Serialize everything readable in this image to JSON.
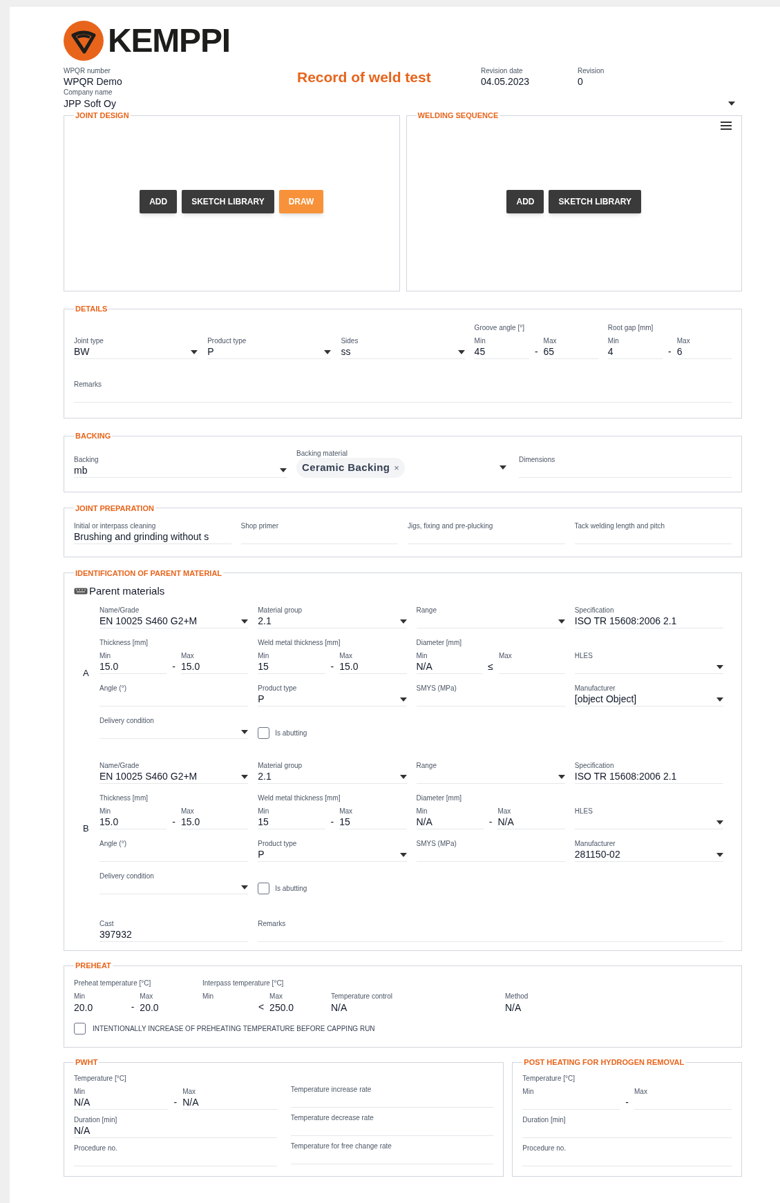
{
  "logo": {
    "text": "KEMPPI"
  },
  "header": {
    "number": {
      "label": "WPQR number",
      "value": "WPQR Demo"
    },
    "title": "Record of weld test",
    "revision_date": {
      "label": "Revision date",
      "value": "04.05.2023"
    },
    "revision": {
      "label": "Revision",
      "value": "0"
    },
    "company": {
      "kind": "dropdown",
      "label": "Company name",
      "value": "JPP Soft Oy"
    }
  },
  "sketch_panels": [
    {
      "title": "JOINT DESIGN",
      "menu": false,
      "buttons": [
        {
          "label": "ADD",
          "primary": false
        },
        {
          "label": "SKETCH LIBRARY",
          "primary": false
        },
        {
          "label": "DRAW",
          "primary": true
        }
      ]
    },
    {
      "title": "WELDING SEQUENCE",
      "menu": true,
      "buttons": [
        {
          "label": "ADD",
          "primary": false
        },
        {
          "label": "SKETCH LIBRARY",
          "primary": false
        }
      ]
    }
  ],
  "sections": [
    {
      "title": "DETAILS",
      "rows": [
        [
          {
            "kind": "dropdown",
            "label": "Joint type",
            "value": "BW"
          },
          {
            "kind": "dropdown",
            "label": "Product type",
            "value": "P"
          },
          {
            "kind": "dropdown",
            "label": "Sides",
            "value": "ss"
          },
          {
            "kind": "range",
            "label": "Groove angle [°]",
            "min_label": "Min",
            "min": "45",
            "separator": "-",
            "max_label": "Max",
            "max": "65"
          },
          {
            "kind": "range",
            "label": "Root gap [mm]",
            "min_label": "Min",
            "min": "4",
            "separator": "-",
            "max_label": "Max",
            "max": "6"
          }
        ],
        [
          {
            "kind": "field",
            "label": "Remarks"
          }
        ]
      ]
    },
    {
      "title": "BACKING",
      "rows": [
        [
          {
            "kind": "dropdown",
            "label": "Backing",
            "value": "mb"
          },
          {
            "kind": "chip",
            "label": "Backing material",
            "chip": "Ceramic Backing",
            "remove": "×"
          },
          {
            "kind": "field",
            "label": "Dimensions"
          }
        ]
      ]
    },
    {
      "title": "JOINT PREPARATION",
      "rows": [
        [
          {
            "kind": "field",
            "label": "Initial or interpass cleaning",
            "value": "Brushing and grinding without s"
          },
          {
            "kind": "field",
            "label": "Shop primer"
          },
          {
            "kind": "field",
            "label": "Jigs, fixing and pre-plucking"
          },
          {
            "kind": "field",
            "label": "Tack welding length and pitch"
          }
        ]
      ]
    }
  ],
  "parent_material": {
    "title": "IDENTIFICATION OF PARENT MATERIAL",
    "heading": "Parent materials",
    "materials": [
      {
        "letter": "A",
        "rows": [
          [
            {
              "kind": "dropdown",
              "label": "Name/Grade",
              "value": "EN 10025 S460 G2+M"
            },
            {
              "kind": "dropdown",
              "label": "Material group",
              "value": "2.1"
            },
            {
              "kind": "dropdown",
              "label": "Range"
            },
            {
              "kind": "field",
              "label": "Specification",
              "value": "ISO TR 15608:2006 2.1"
            }
          ],
          [
            {
              "kind": "range",
              "label": "Thickness [mm]",
              "min_label": "Min",
              "min": "15.0",
              "separator": "-",
              "max_label": "Max",
              "max": "15.0"
            },
            {
              "kind": "range",
              "label": "Weld metal thickness [mm]",
              "min_label": "Min",
              "min": "15",
              "separator": "-",
              "max_label": "Max",
              "max": "15.0"
            },
            {
              "kind": "range",
              "label": "Diameter [mm]",
              "min_label": "Min",
              "min": "N/A",
              "separator": "≤",
              "max_label": "Max"
            },
            {
              "kind": "dropdown",
              "label": "HLES"
            }
          ],
          [
            {
              "kind": "field",
              "label": "Angle (°)"
            },
            {
              "kind": "dropdown",
              "label": "Product type",
              "value": "P"
            },
            {
              "kind": "field",
              "label": "SMYS (MPa)"
            },
            {
              "kind": "dropdown",
              "label": "Manufacturer",
              "value": "[object Object]"
            }
          ],
          [
            {
              "kind": "dropdown",
              "label": "Delivery condition"
            },
            {
              "kind": "checkbox",
              "label": "Is abutting",
              "checked": false
            }
          ]
        ]
      },
      {
        "letter": "B",
        "rows": [
          [
            {
              "kind": "dropdown",
              "label": "Name/Grade",
              "value": "EN 10025 S460 G2+M"
            },
            {
              "kind": "dropdown",
              "label": "Material group",
              "value": "2.1"
            },
            {
              "kind": "dropdown",
              "label": "Range"
            },
            {
              "kind": "field",
              "label": "Specification",
              "value": "ISO TR 15608:2006 2.1"
            }
          ],
          [
            {
              "kind": "range",
              "label": "Thickness [mm]",
              "min_label": "Min",
              "min": "15.0",
              "separator": "-",
              "max_label": "Max",
              "max": "15.0"
            },
            {
              "kind": "range",
              "label": "Weld metal thickness [mm]",
              "min_label": "Min",
              "min": "15",
              "separator": "-",
              "max_label": "Max",
              "max": "15"
            },
            {
              "kind": "range",
              "label": "Diameter [mm]",
              "min_label": "Min",
              "min": "N/A",
              "separator": "-",
              "max_label": "Max",
              "max": "N/A"
            },
            {
              "kind": "dropdown",
              "label": "HLES"
            }
          ],
          [
            {
              "kind": "field",
              "label": "Angle (°)"
            },
            {
              "kind": "dropdown",
              "label": "Product type",
              "value": "P"
            },
            {
              "kind": "field",
              "label": "SMYS (MPa)"
            },
            {
              "kind": "dropdown",
              "label": "Manufacturer",
              "value": "281150-02"
            }
          ],
          [
            {
              "kind": "dropdown",
              "label": "Delivery condition"
            },
            {
              "kind": "checkbox",
              "label": "Is abutting",
              "checked": false
            }
          ],
          [
            {
              "kind": "field",
              "label": "Cast",
              "value": "397932"
            },
            {
              "kind": "field",
              "label": "Remarks"
            }
          ]
        ]
      }
    ]
  },
  "preheat": {
    "title": "PREHEAT",
    "cells": [
      {
        "kind": "range",
        "label": "Preheat temperature [°C]",
        "min_label": "Min",
        "min": "20.0",
        "separator": "-",
        "max_label": "Max",
        "max": "20.0"
      },
      {
        "kind": "range",
        "label": "Interpass temperature [°C]",
        "min_label": "Min",
        "separator": "<",
        "max_label": "Max",
        "max": "250.0"
      },
      {
        "kind": "field",
        "label": "Temperature control",
        "value": "N/A"
      },
      {
        "kind": "field",
        "label": "Method",
        "value": "N/A"
      }
    ],
    "checkbox": {
      "label": "INTENTIONALLY INCREASE OF PREHEATING TEMPERATURE BEFORE CAPPING RUN",
      "checked": false
    }
  },
  "bottom_sections": [
    {
      "title": "PWHT",
      "columns": [
        [
          {
            "kind": "range",
            "label": "Temperature [°C]",
            "min_label": "Min",
            "min": "N/A",
            "separator": "-",
            "max_label": "Max",
            "max": "N/A"
          },
          {
            "kind": "field",
            "label": "Duration [min]",
            "value": "N/A"
          },
          {
            "kind": "field",
            "label": "Procedure no."
          }
        ],
        [
          {
            "kind": "field",
            "label": "Temperature increase rate"
          },
          {
            "kind": "field",
            "label": "Temperature decrease rate"
          },
          {
            "kind": "field",
            "label": "Temperature for free change rate"
          }
        ]
      ]
    },
    {
      "title": "POST HEATING FOR HYDROGEN REMOVAL",
      "columns": [
        [
          {
            "kind": "range",
            "label": "Temperature [°C]",
            "min_label": "Min",
            "separator": "-",
            "max_label": "Max"
          },
          {
            "kind": "field",
            "label": "Duration [min]"
          },
          {
            "kind": "field",
            "label": "Procedure no."
          }
        ]
      ]
    }
  ]
}
